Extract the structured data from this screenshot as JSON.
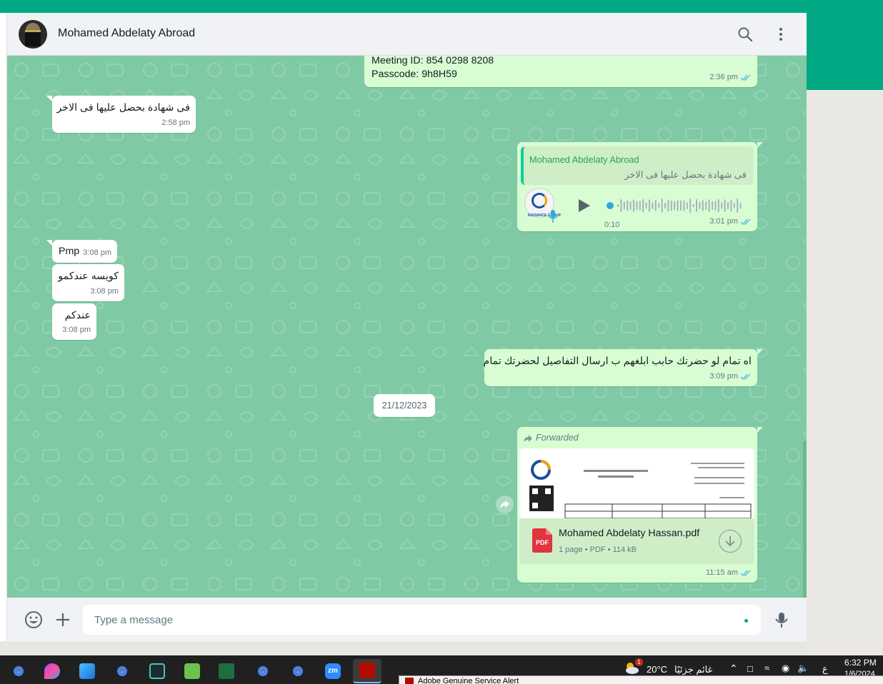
{
  "header": {
    "contact_name": "Mohamed Abdelaty Abroad"
  },
  "messages": [
    {
      "direction": "out",
      "lines": [
        "Meeting ID: 854 0298 8208",
        "Passcode: 9h8H59"
      ],
      "time": "2:36 pm"
    },
    {
      "direction": "in",
      "text": "فى شهادة بحصل عليها فى الاخر",
      "time": "2:58 pm"
    },
    {
      "direction": "out",
      "type": "voice",
      "quote_name": "Mohamed Abdelaty Abroad",
      "quote_text": "فى شهادة بحصل عليها فى الاخر",
      "duration": "0:10",
      "time": "3:01 pm",
      "avatar_logo_text": "RADIANCE GROUP"
    },
    {
      "direction": "in",
      "text": "Pmp",
      "time": "3:08 pm"
    },
    {
      "direction": "in",
      "text": "كويسه عندكمو",
      "time": "3:08 pm"
    },
    {
      "direction": "in",
      "text": "عندكم",
      "time": "3:08 pm"
    },
    {
      "direction": "out",
      "text": "اه تمام لو حضرتك حابب ابلغهم ب ارسال التفاصيل لحضرتك تمام",
      "time": "3:09 pm"
    },
    {
      "direction": "out",
      "type": "document",
      "forwarded_label": "Forwarded",
      "file_name": "Mohamed Abdelaty Hassan.pdf",
      "file_meta": "1 page • PDF • 114 kB",
      "file_badge": "PDF",
      "time": "11:15 am"
    }
  ],
  "date_divider": "21/12/2023",
  "composer": {
    "placeholder": "Type a message"
  },
  "taskbar": {
    "weather_temp": "20°C",
    "weather_text": "غائم جزئيًا",
    "weather_badge": "1",
    "time": "6:32 PM",
    "date": "1/6/2024",
    "lang": "ع",
    "apps": [
      "chrome-icon",
      "paint-icon",
      "photos-icon",
      "chrome-profile-icon",
      "capcut-icon",
      "camtasia-icon",
      "excel-icon",
      "chrome-profile-2-icon",
      "chrome-profile-3-icon",
      "zoom-icon",
      "acrobat-icon"
    ],
    "zoom_label": "zm"
  },
  "popup": {
    "title": "Adobe Genuine Service Alert"
  },
  "colors": {
    "accent": "#00a884",
    "chat_bg": "#7fcaa4",
    "outgoing": "#d9fdd3",
    "incoming": "#ffffff",
    "tick_blue": "#53bdeb"
  }
}
